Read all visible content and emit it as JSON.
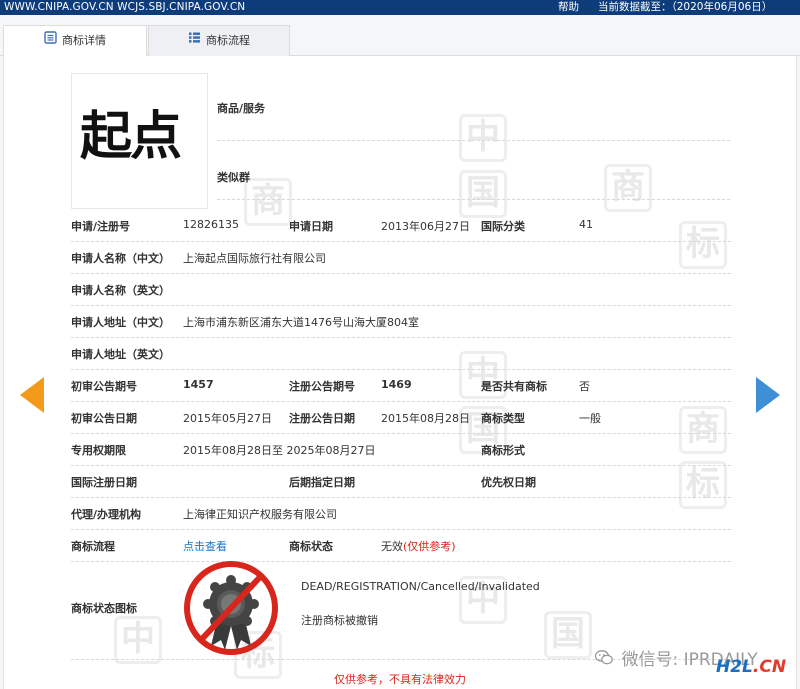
{
  "topbar": {
    "site": "WWW.CNIPA.GOV.CN WCJS.SBJ.CNIPA.GOV.CN",
    "help": "帮助",
    "data_date": "当前数据截至：（2020年06月06日）"
  },
  "tabs": [
    {
      "label": "商标详情",
      "icon": "document-icon",
      "active": true
    },
    {
      "label": "商标流程",
      "icon": "list-icon",
      "active": false
    }
  ],
  "watermark_chars": [
    "中",
    "国",
    "商",
    "标"
  ],
  "trademark": {
    "logo_text": "起点",
    "goods_label": "商品/服务",
    "similar_label": "类似群"
  },
  "details": {
    "reg_no_label": "申请/注册号",
    "reg_no": "12826135",
    "app_date_label": "申请日期",
    "app_date": "2013年06月27日",
    "intl_class_label": "国际分类",
    "intl_class": "41",
    "applicant_cn_label": "申请人名称（中文）",
    "applicant_cn": "上海起点国际旅行社有限公司",
    "applicant_en_label": "申请人名称（英文）",
    "applicant_en": "",
    "address_cn_label": "申请人地址（中文）",
    "address_cn": "上海市浦东新区浦东大道1476号山海大厦804室",
    "address_en_label": "申请人地址（英文）",
    "address_en": "",
    "prelim_no_label": "初审公告期号",
    "prelim_no": "1457",
    "reg_ann_no_label": "注册公告期号",
    "reg_ann_no": "1469",
    "shared_label": "是否共有商标",
    "shared": "否",
    "prelim_date_label": "初审公告日期",
    "prelim_date": "2015年05月27日",
    "reg_ann_date_label": "注册公告日期",
    "reg_ann_date": "2015年08月28日",
    "tm_type_label": "商标类型",
    "tm_type": "一般",
    "exclusive_label": "专用权期限",
    "exclusive": "2015年08月28日至 2025年08月27日",
    "tm_form_label": "商标形式",
    "tm_form": "",
    "intl_reg_date_label": "国际注册日期",
    "intl_reg_date": "",
    "later_date_label": "后期指定日期",
    "later_date": "",
    "priority_date_label": "优先权日期",
    "priority_date": "",
    "agent_label": "代理/办理机构",
    "agent": "上海律正知识产权服务有限公司",
    "process_label": "商标流程",
    "process_link": "点击查看",
    "status_label": "商标状态",
    "status_value": "无效",
    "status_note": "(仅供参考)"
  },
  "status_icon": {
    "label": "商标状态图标",
    "icon": "invalid-ribbon-icon",
    "en_text": "DEAD/REGISTRATION/Cancelled/Invalidated",
    "cn_text": "注册商标被撤销"
  },
  "disclaimer": "仅供参考，不具有法律效力",
  "watermarks": {
    "wechat": "微信号: IPRDAILY",
    "h2l_a": "H2L",
    "h2l_b": ".CN"
  },
  "colors": {
    "topbar": "#0e3c7a",
    "link": "#1a73c4",
    "warning_red": "#d9261c",
    "arrow_left": "#f39a1a",
    "arrow_right": "#3f8fd6"
  }
}
